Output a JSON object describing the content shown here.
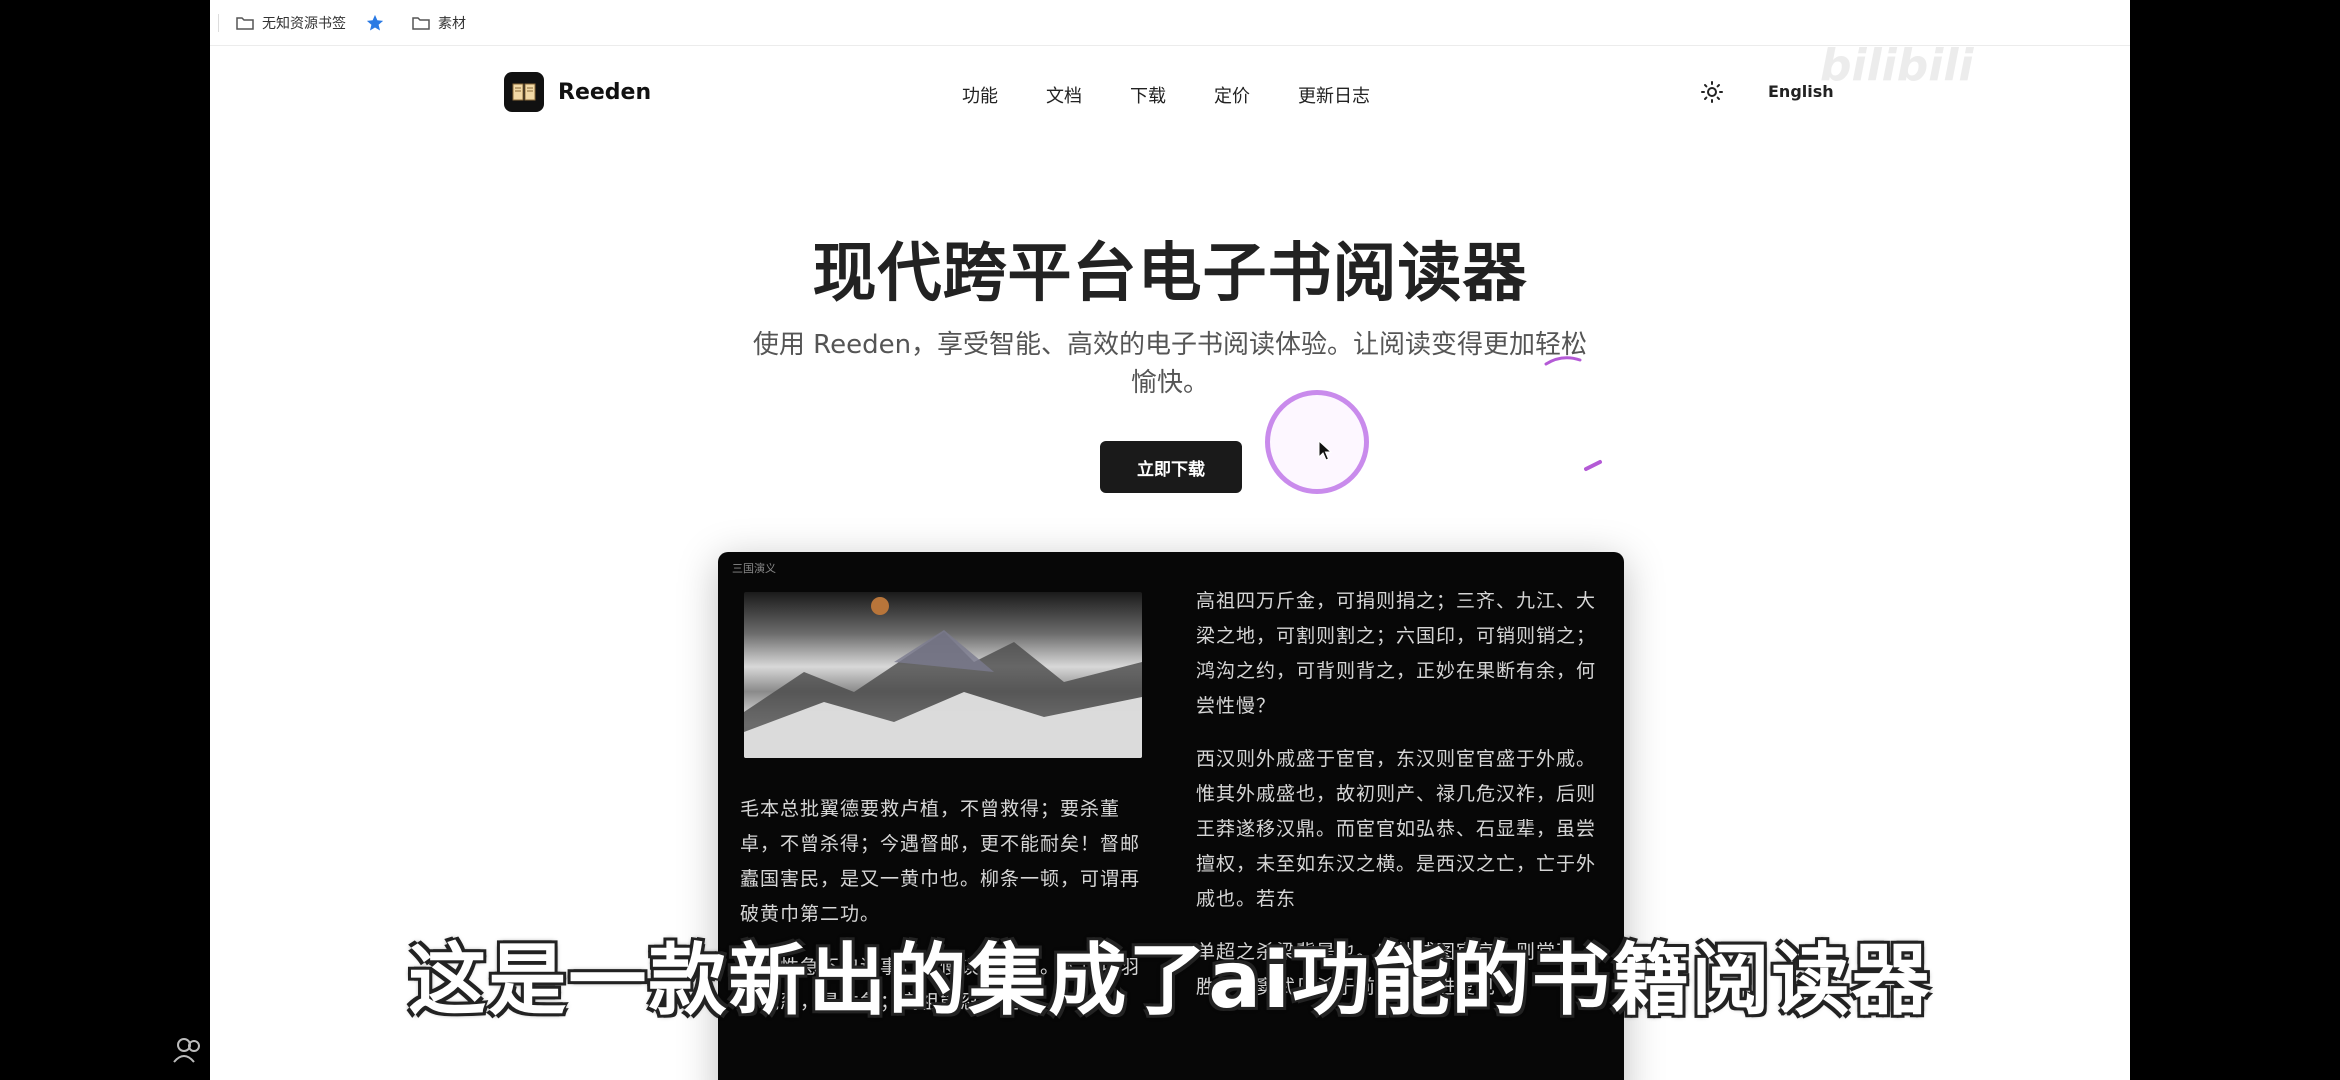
{
  "bookmarks": {
    "items": [
      {
        "label": "无知资源书签",
        "icon": "folder-icon"
      },
      {
        "label": "",
        "icon": "star-icon"
      },
      {
        "label": "素材",
        "icon": "folder-icon"
      }
    ]
  },
  "header": {
    "brand": "Reeden",
    "nav": [
      "功能",
      "文档",
      "下载",
      "定价",
      "更新日志"
    ],
    "theme_icon": "sun-icon",
    "language": "English"
  },
  "hero": {
    "title": "现代跨平台电子书阅读器",
    "subtitle_line1": "使用 Reeden，享受智能、高效的电子书阅读体验。让阅读变得更加轻松",
    "subtitle_line2": "愉快。",
    "cta": "立即下载"
  },
  "reader": {
    "book_title": "三国演义",
    "left_paragraphs": [
      "毛本总批翼德要救卢植，不曾救得；要杀董卓，不曾杀得；今遇督邮，更不能耐矣！督邮蠹国害民，是又一黄巾也。柳条一顿，可谓再破黄巾第二功。",
      "慢。性急不曾误事，性慢误事不小。人谓项羽不能忍，是性急；高祖能忍，是"
    ],
    "right_paragraphs": [
      "高祖四万斤金，可捐则捐之；三齐、九江、大梁之地，可割则割之；六国印，可销则销之；鸿沟之约，可背则背之，正妙在果断有余，何尝性慢？",
      "西汉则外戚盛于宦官，东汉则宦官盛于外戚。惟其外戚盛也，故初则产、禄几危汉祚，后则王莽遂移汉鼎。而宦官如弘恭、石显辈，虽尝擅权，未至如东汉之横。是西汉之亡，亡于外戚也。若东",
      "单超之杀梁冀是也。以外戚图宦官，则常不胜，如窦武见杀于前，而何进复见"
    ]
  },
  "watermark": "bilibili",
  "video_subtitle": "这是一款新出的集成了ai功能的书籍阅读器",
  "colors": {
    "accent_ring": "#c98bec",
    "button_bg": "#1a1a1a",
    "reader_bg": "#070707"
  }
}
